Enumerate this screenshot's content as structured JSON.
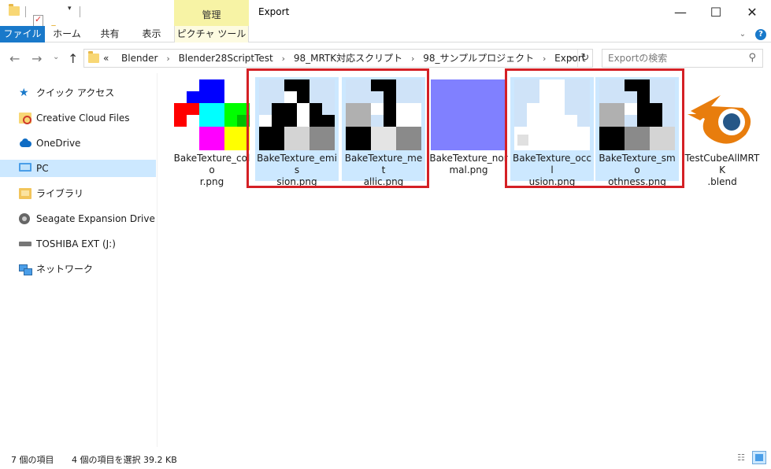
{
  "window": {
    "title": "Export",
    "context_tab_group": "管理",
    "controls": {
      "minimize": "—",
      "maximize": "☐",
      "close": "✕"
    }
  },
  "ribbon": {
    "tabs": [
      {
        "label": "ファイル",
        "active": true
      },
      {
        "label": "ホーム"
      },
      {
        "label": "共有"
      },
      {
        "label": "表示"
      },
      {
        "label": "ピクチャ ツール",
        "contextual": true
      }
    ],
    "help_icon": "?"
  },
  "address": {
    "prefix": "«",
    "breadcrumb": [
      "Blender",
      "Blender28ScriptTest",
      "98_MRTK対応スクリプト",
      "98_サンプルプロジェクト",
      "Export"
    ],
    "separator": "›"
  },
  "search": {
    "placeholder": "Exportの検索"
  },
  "sidebar": {
    "items": [
      {
        "label": "クイック アクセス",
        "icon": "star-icon"
      },
      {
        "label": "Creative Cloud Files",
        "icon": "creative-cloud-folder-icon"
      },
      {
        "label": "OneDrive",
        "icon": "cloud-icon"
      },
      {
        "label": "PC",
        "icon": "pc-icon",
        "selected": true
      },
      {
        "label": "ライブラリ",
        "icon": "library-icon"
      },
      {
        "label": "Seagate Expansion Drive (G:)",
        "icon": "drive-icon"
      },
      {
        "label": "TOSHIBA EXT (J:)",
        "icon": "usb-drive-icon"
      },
      {
        "label": "ネットワーク",
        "icon": "network-icon"
      }
    ]
  },
  "files": [
    {
      "name": "BakeTexture_color.png",
      "line1": "BakeTexture_colo",
      "line2": "r.png",
      "selected": false
    },
    {
      "name": "BakeTexture_emission.png",
      "line1": "BakeTexture_emis",
      "line2": "sion.png",
      "selected": true
    },
    {
      "name": "BakeTexture_metallic.png",
      "line1": "BakeTexture_met",
      "line2": "allic.png",
      "selected": true
    },
    {
      "name": "BakeTexture_normal.png",
      "line1": "BakeTexture_nor",
      "line2": "mal.png",
      "selected": false
    },
    {
      "name": "BakeTexture_occlusion.png",
      "line1": "BakeTexture_occl",
      "line2": "usion.png",
      "selected": true
    },
    {
      "name": "BakeTexture_smoothness.png",
      "line1": "BakeTexture_smo",
      "line2": "othness.png",
      "selected": true
    },
    {
      "name": "TestCubeAllMRTK.blend",
      "line1": "TestCubeAllMRTK",
      "line2": ".blend",
      "selected": false
    }
  ],
  "status": {
    "item_count": "7 個の項目",
    "selection": "4 個の項目を選択  39.2 KB"
  },
  "colors": {
    "accent": "#1979ca",
    "selection": "#cce8ff",
    "highlight_box": "#d42025",
    "context_tab": "#f7f3a5",
    "normal_map": "#8080ff"
  }
}
